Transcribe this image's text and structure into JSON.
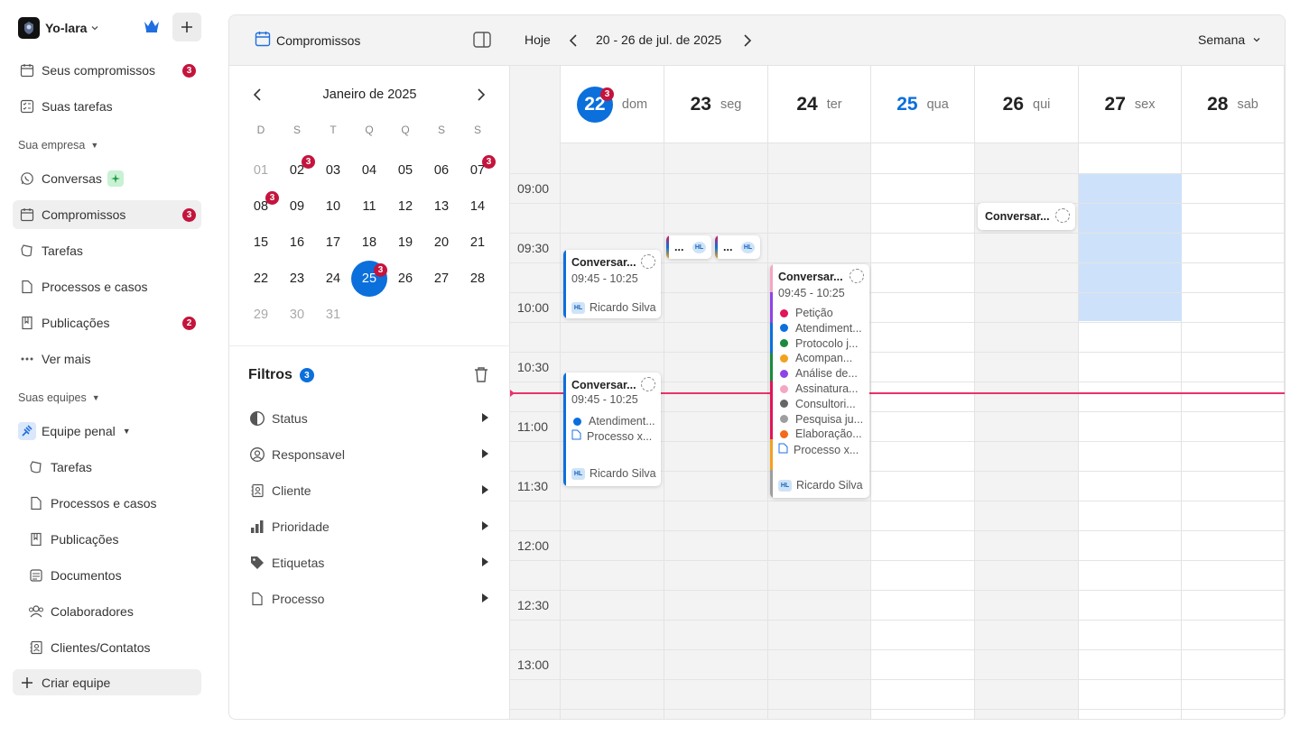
{
  "workspace": {
    "name": "Yo-lara"
  },
  "sidebar": {
    "top_items": [
      {
        "label": "Seus compromissos",
        "badge": "3"
      },
      {
        "label": "Suas tarefas",
        "badge": ""
      }
    ],
    "company_section": "Sua empresa",
    "company_items": [
      {
        "label": "Conversas",
        "badge": ""
      },
      {
        "label": "Compromissos",
        "badge": "3"
      },
      {
        "label": "Tarefas",
        "badge": ""
      },
      {
        "label": "Processos e casos",
        "badge": ""
      },
      {
        "label": "Publicações",
        "badge": "2"
      },
      {
        "label": "Ver mais",
        "badge": ""
      }
    ],
    "teams_section": "Suas equipes",
    "team": {
      "label": "Equipe penal"
    },
    "team_items": [
      {
        "label": "Tarefas"
      },
      {
        "label": "Processos e casos"
      },
      {
        "label": "Publicações"
      },
      {
        "label": "Documentos"
      },
      {
        "label": "Colaboradores"
      },
      {
        "label": "Clientes/Contatos"
      }
    ],
    "create_team": "Criar equipe"
  },
  "left_panel": {
    "title": "Compromissos",
    "mini_calendar": {
      "month_label": "Janeiro de 2025",
      "weekdays": [
        "D",
        "S",
        "T",
        "Q",
        "Q",
        "S",
        "S"
      ],
      "rows": [
        [
          "01",
          "02",
          "03",
          "04",
          "05",
          "06",
          "07"
        ],
        [
          "08",
          "09",
          "10",
          "11",
          "12",
          "13",
          "14"
        ],
        [
          "15",
          "16",
          "17",
          "18",
          "19",
          "20",
          "21"
        ],
        [
          "22",
          "23",
          "24",
          "25",
          "26",
          "27",
          "28"
        ],
        [
          "29",
          "30",
          "31"
        ]
      ],
      "selected_day": "25",
      "badges": {
        "02": "3",
        "07": "3",
        "08": "3",
        "25": "3"
      }
    },
    "filters_title": "Filtros",
    "filters_count": "3",
    "filters": [
      "Status",
      "Responsavel",
      "Cliente",
      "Prioridade",
      "Etiquetas",
      "Processo"
    ]
  },
  "calendar": {
    "today_label": "Hoje",
    "range_label": "20 - 26 de jul. de 2025",
    "view_label": "Semana",
    "days": [
      {
        "num": "22",
        "wd": "dom",
        "badge": "3"
      },
      {
        "num": "23",
        "wd": "seg"
      },
      {
        "num": "24",
        "wd": "ter"
      },
      {
        "num": "25",
        "wd": "qua"
      },
      {
        "num": "26",
        "wd": "qui"
      },
      {
        "num": "27",
        "wd": "sex"
      },
      {
        "num": "28",
        "wd": "sab"
      }
    ],
    "time_labels": [
      "09:00",
      "09:30",
      "10:00",
      "10:30",
      "11:00",
      "11:30",
      "12:00",
      "12:30",
      "13:00"
    ],
    "events": {
      "e1": {
        "title": "Conversar...",
        "time": "09:45 - 10:25",
        "person": "Ricardo Silva",
        "initials": "HL"
      },
      "e2": {
        "title": "Conversar...",
        "time": "09:45 - 10:25",
        "tags": [
          "Atendiment...",
          "Processo x..."
        ],
        "person": "Ricardo Silva",
        "initials": "HL"
      },
      "e3": {
        "title": "Conversar...",
        "time": "09:45 - 10:25",
        "tags": [
          "Petição",
          "Atendiment...",
          "Protocolo j...",
          "Acompan...",
          "Análise de...",
          "Assinatura...",
          "Consultori...",
          "Pesquisa ju...",
          "Elaboração...",
          "Processo x..."
        ],
        "tag_colors": [
          "#e0155a",
          "#0b6fdc",
          "#1c8a3e",
          "#f2a11f",
          "#8e44e6",
          "#f4a6c4",
          "#666666",
          "#9e9e9e",
          "#f26a1b",
          ""
        ],
        "person": "Ricardo Silva",
        "initials": "HL"
      },
      "e4": {
        "title": "Conversar..."
      },
      "mini1": {
        "title": "...",
        "initials": "HL"
      },
      "mini2": {
        "title": "...",
        "initials": "HL"
      }
    }
  }
}
